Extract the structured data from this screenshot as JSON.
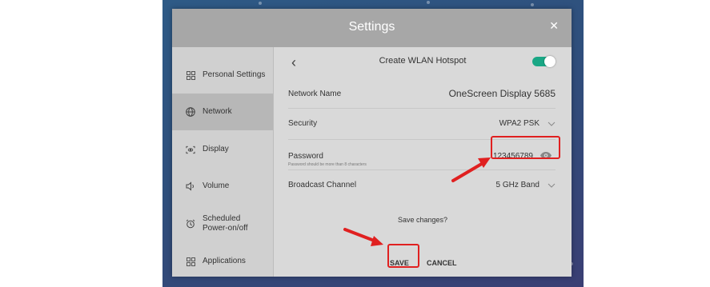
{
  "dialog": {
    "title": "Settings",
    "close_icon": "close-icon"
  },
  "sidebar": {
    "items": [
      {
        "label": "Personal Settings",
        "icon": "grid-icon"
      },
      {
        "label": "Network",
        "icon": "globe-icon",
        "active": true
      },
      {
        "label": "Display",
        "icon": "display-icon"
      },
      {
        "label": "Volume",
        "icon": "speaker-icon"
      },
      {
        "label": "Scheduled Power-on/off",
        "label_line1": "Scheduled",
        "label_line2": "Power-on/off",
        "icon": "alarm-clock-icon"
      },
      {
        "label": "Applications",
        "icon": "grid-icon"
      }
    ]
  },
  "hotspot": {
    "title": "Create WLAN Hotspot",
    "enabled": true,
    "network_name_label": "Network Name",
    "network_name_value": "OneScreen Display 5685",
    "security_label": "Security",
    "security_value": "WPA2 PSK",
    "password_label": "Password",
    "password_hint": "Password should be more than 8 characters",
    "password_value": "123456789",
    "channel_label": "Broadcast Channel",
    "channel_value": "5 GHz Band",
    "save_question": "Save changes?",
    "save_label": "SAVE",
    "cancel_label": "CANCEL"
  },
  "colors": {
    "accent": "#1aa785",
    "annotation": "#e02020",
    "titlebar": "#a7a7a7"
  }
}
